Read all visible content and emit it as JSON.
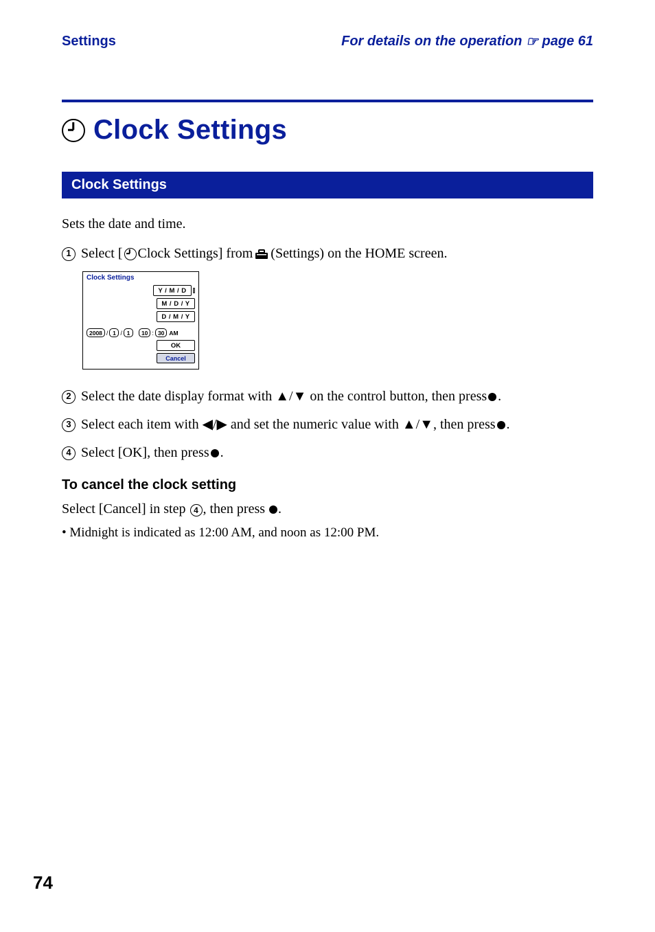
{
  "header": {
    "left": "Settings",
    "right_prefix": "For details on the operation ",
    "right_linkword": " page 61"
  },
  "title": "Clock Settings",
  "section_bar": "Clock Settings",
  "lead": "Sets the date and time.",
  "steps": {
    "s1_before_icon": "Select [",
    "s1_after_icon": " Clock Settings] from ",
    "s1_after_toolbox": " (Settings) on the HOME screen.",
    "s2": "Select the date display format with ▲/▼ on the control button, then press ",
    "s2_end": ".",
    "s3": "Select each item with ◀/▶ and set the numeric value with ▲/▼, then press ",
    "s3_end": ".",
    "s4": "Select [OK], then press ",
    "s4_end": "."
  },
  "step_numbers": {
    "n1": "1",
    "n2": "2",
    "n3": "3",
    "n4": "4"
  },
  "screenshot": {
    "title": "Clock Settings",
    "formats": [
      "Y / M / D",
      "M / D / Y",
      "D / M / Y"
    ],
    "date": {
      "year": "2008",
      "month": "1",
      "day": "1",
      "hour": "10",
      "minute": "30",
      "ampm": "AM"
    },
    "ok": "OK",
    "cancel": "Cancel"
  },
  "subhead": "To cancel the clock setting",
  "cancel_line_before": "Select [Cancel] in step ",
  "cancel_step_ref": "4",
  "cancel_line_after": ", then press ",
  "cancel_line_end": ".",
  "bullet": "•  Midnight is indicated as 12:00 AM, and noon as 12:00 PM.",
  "page_number": "74"
}
